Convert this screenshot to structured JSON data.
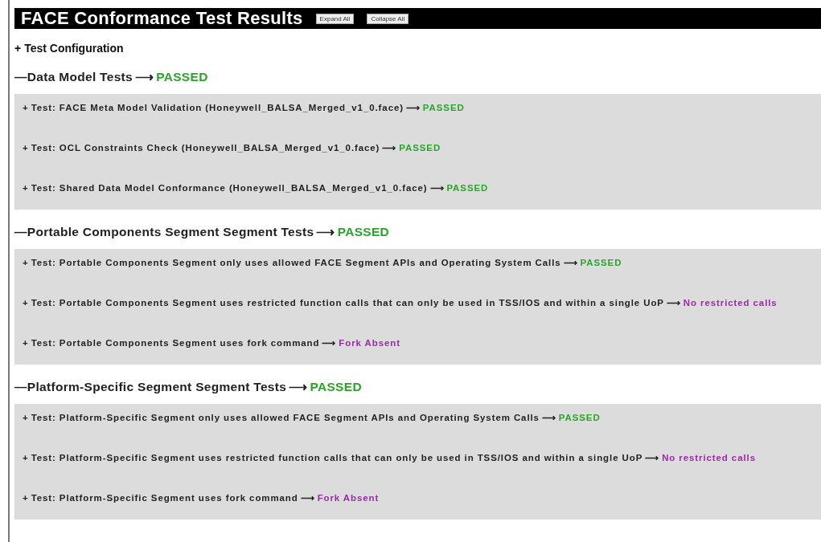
{
  "header": {
    "title": "FACE Conformance Test Results",
    "buttons": [
      "Expand All",
      "Collapse All"
    ]
  },
  "config": {
    "toggle": "+",
    "label": "Test Configuration"
  },
  "sections": [
    {
      "toggle": "—",
      "title": "Data Model Tests",
      "arrow": "⟶",
      "result": "PASSED",
      "kind": "passed",
      "tests": [
        {
          "toggle": "+",
          "label": "Test: FACE Meta Model Validation (Honeywell_BALSA_Merged_v1_0.face)",
          "arrow": "⟶",
          "result": "PASSED",
          "kind": "passed"
        },
        {
          "toggle": "+",
          "label": "Test: OCL Constraints Check (Honeywell_BALSA_Merged_v1_0.face)",
          "arrow": "⟶",
          "result": "PASSED",
          "kind": "passed"
        },
        {
          "toggle": "+",
          "label": "Test: Shared Data Model Conformance (Honeywell_BALSA_Merged_v1_0.face)",
          "arrow": "⟶",
          "result": "PASSED",
          "kind": "passed"
        }
      ]
    },
    {
      "toggle": "—",
      "title": "Portable Components Segment Segment Tests",
      "arrow": "⟶",
      "result": "PASSED",
      "kind": "passed",
      "tests": [
        {
          "toggle": "+",
          "label": "Test: Portable Components Segment only uses allowed FACE Segment APIs and Operating System Calls",
          "arrow": "⟶",
          "result": "PASSED",
          "kind": "passed"
        },
        {
          "toggle": "+",
          "label": "Test: Portable Components Segment uses restricted function calls that can only be used in TSS/IOS and within a single UoP",
          "arrow": "⟶",
          "result": "No restricted calls",
          "kind": "info"
        },
        {
          "toggle": "+",
          "label": "Test: Portable Components Segment uses fork command",
          "arrow": "⟶",
          "result": "Fork Absent",
          "kind": "info"
        }
      ]
    },
    {
      "toggle": "—",
      "title": "Platform-Specific Segment Segment Tests",
      "arrow": "⟶",
      "result": "PASSED",
      "kind": "passed",
      "tests": [
        {
          "toggle": "+",
          "label": "Test: Platform-Specific Segment only uses allowed FACE Segment APIs and Operating System Calls",
          "arrow": "⟶",
          "result": "PASSED",
          "kind": "passed"
        },
        {
          "toggle": "+",
          "label": "Test: Platform-Specific Segment uses restricted function calls that can only be used in TSS/IOS and within a single UoP",
          "arrow": "⟶",
          "result": "No restricted calls",
          "kind": "info"
        },
        {
          "toggle": "+",
          "label": "Test: Platform-Specific Segment uses fork command",
          "arrow": "⟶",
          "result": "Fork Absent",
          "kind": "info"
        }
      ]
    }
  ]
}
